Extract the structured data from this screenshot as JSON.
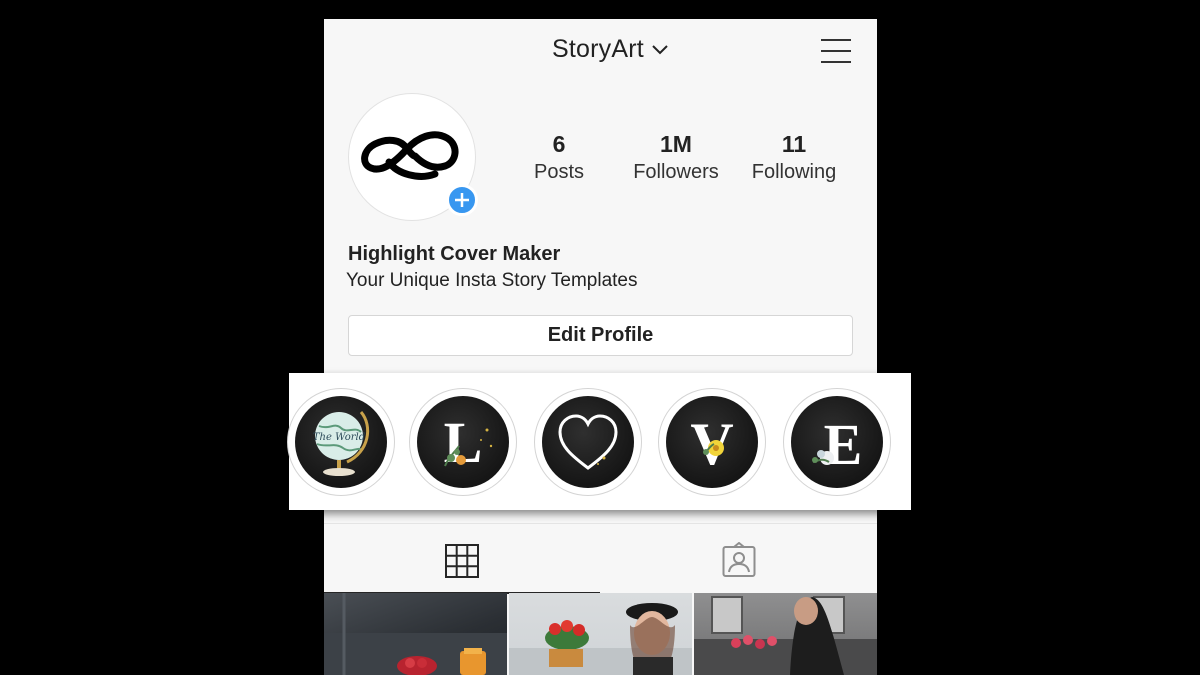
{
  "profile": {
    "username": "StoryArt",
    "name": "Highlight Cover Maker",
    "bio": "Your Unique Insta Story Templates",
    "edit_button": "Edit Profile"
  },
  "stats": [
    {
      "value": "6",
      "label": "Posts"
    },
    {
      "value": "1M",
      "label": "Followers"
    },
    {
      "value": "11",
      "label": "Following"
    }
  ],
  "highlights": [
    {
      "cover": "The World",
      "icon": "globe-icon"
    },
    {
      "cover": "L",
      "icon": "letter-l-icon"
    },
    {
      "cover": "",
      "icon": "heart-icon"
    },
    {
      "cover": "V",
      "icon": "letter-v-icon"
    },
    {
      "cover": "E",
      "icon": "letter-e-icon"
    }
  ],
  "tabs": [
    {
      "icon": "grid-icon",
      "active": true
    },
    {
      "icon": "tagged-icon",
      "active": false
    }
  ],
  "icons": {
    "account_switch": "chevron-down-icon",
    "menu": "hamburger-menu-icon",
    "avatar": "storyart-logo-icon",
    "add_story": "plus-icon"
  },
  "colors": {
    "accent": "#3897f0",
    "highlight_fill": "#1b1b1b",
    "page_background": "#f7f7f7"
  }
}
